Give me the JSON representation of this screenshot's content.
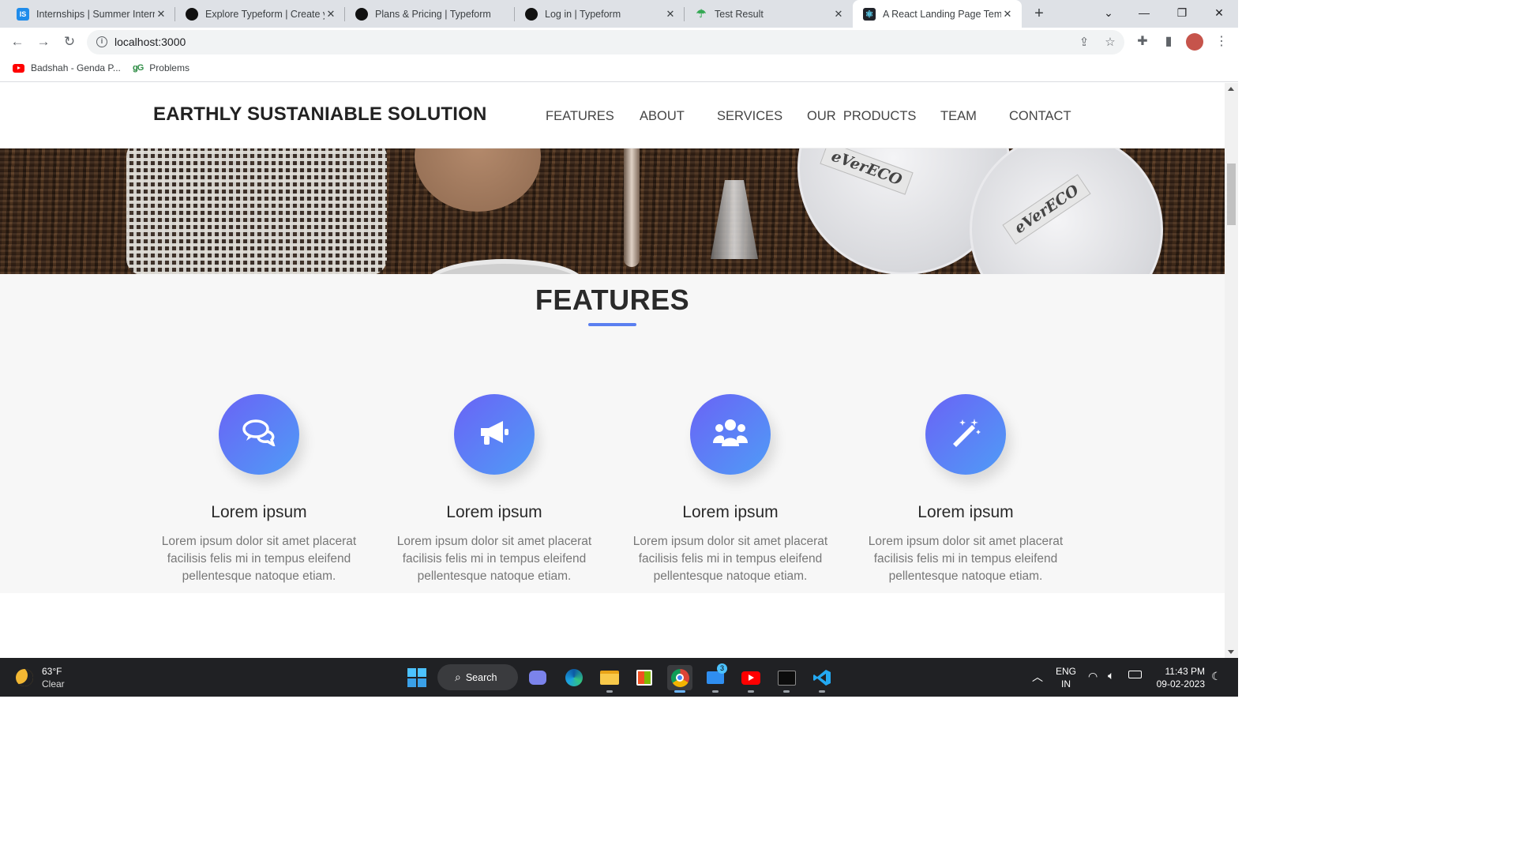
{
  "browser": {
    "tabs": [
      {
        "title": "Internships | Summer Intern",
        "icon": "is-icon",
        "active": false
      },
      {
        "title": "Explore Typeform | Create y",
        "icon": "typeform-icon",
        "active": false
      },
      {
        "title": "Plans & Pricing | Typeform",
        "icon": "typeform-icon",
        "active": false
      },
      {
        "title": "Log in | Typeform",
        "icon": "typeform-icon",
        "active": false
      },
      {
        "title": "Test Result",
        "icon": "umbrella-icon",
        "active": false
      },
      {
        "title": "A React Landing Page Temp",
        "icon": "react-icon",
        "active": true
      }
    ],
    "new_tab_label": "+",
    "url": "localhost:3000",
    "bookmarks": [
      {
        "label": "Badshah - Genda P...",
        "icon": "youtube-icon"
      },
      {
        "label": "Problems",
        "icon": "geeksforgeeks-icon",
        "icon_text": "ǥG"
      }
    ]
  },
  "site": {
    "brand": "EARTHLY SUSTANIABLE SOLUTION",
    "nav": [
      "FEATURES",
      "ABOUT",
      "SERVICES",
      "OUR  PRODUCTS",
      "TEAM",
      "CONTACT"
    ],
    "hero_tags": [
      "eVerECO",
      "eVerECO"
    ],
    "features": {
      "heading": "FEATURES",
      "accent_color": "#5a7ff0",
      "items": [
        {
          "icon": "comments-icon",
          "title": "Lorem ipsum",
          "desc": "Lorem ipsum dolor sit amet placerat facilisis felis mi in tempus eleifend pellentesque natoque etiam."
        },
        {
          "icon": "megaphone-icon",
          "title": "Lorem ipsum",
          "desc": "Lorem ipsum dolor sit amet placerat facilisis felis mi in tempus eleifend pellentesque natoque etiam."
        },
        {
          "icon": "users-icon",
          "title": "Lorem ipsum",
          "desc": "Lorem ipsum dolor sit amet placerat facilisis felis mi in tempus eleifend pellentesque natoque etiam."
        },
        {
          "icon": "magic-wand-icon",
          "title": "Lorem ipsum",
          "desc": "Lorem ipsum dolor sit amet placerat facilisis felis mi in tempus eleifend pellentesque natoque etiam."
        }
      ]
    }
  },
  "taskbar": {
    "weather": {
      "temp": "63°F",
      "condition": "Clear"
    },
    "search_label": "Search",
    "mail_badge": "3",
    "language": {
      "line1": "ENG",
      "line2": "IN"
    },
    "time": "11:43 PM",
    "date": "09-02-2023"
  }
}
